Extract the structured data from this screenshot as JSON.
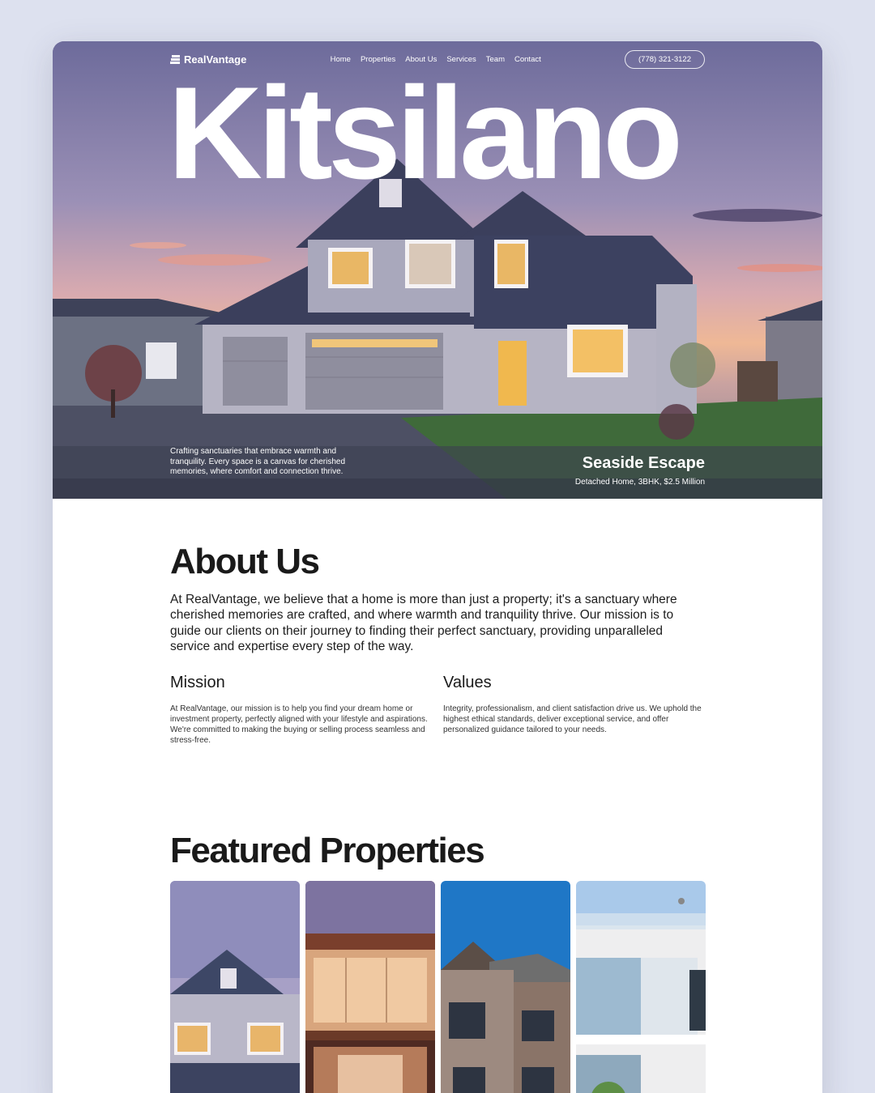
{
  "brand": {
    "name": "RealVantage",
    "logo_icon": "building-stack-icon"
  },
  "nav": {
    "items": [
      "Home",
      "Properties",
      "About Us",
      "Services",
      "Team",
      "Contact"
    ],
    "phone": "(778) 321-3122"
  },
  "hero": {
    "title": "Kitsilano",
    "tagline": "Crafting sanctuaries that embrace warmth and tranquility. Every space is a canvas for cherished memories, where comfort and connection thrive.",
    "listing_name": "Seaside Escape",
    "listing_meta": "Detached Home, 3BHK, $2.5 Million"
  },
  "about": {
    "title": "About Us",
    "text": "At RealVantage, we believe that a home is more than just a property; it's a sanctuary where cherished memories are crafted, and where warmth and tranquility thrive. Our mission is to guide our clients on their journey to finding their perfect sanctuary, providing unparalleled service and expertise every step of the way.",
    "mission_title": "Mission",
    "mission_text": "At RealVantage, our mission is to help you find your dream home or investment property, perfectly aligned with your lifestyle and aspirations. We're committed to making the buying or selling process seamless and stress-free.",
    "values_title": "Values",
    "values_text": "Integrity, professionalism, and client satisfaction drive us. We uphold the highest ethical standards, deliver exceptional service, and offer personalized guidance tailored to your needs."
  },
  "featured": {
    "title": "Featured Properties"
  },
  "colors": {
    "background": "#dde1ef",
    "text": "#1a1a1a",
    "white": "#ffffff"
  }
}
